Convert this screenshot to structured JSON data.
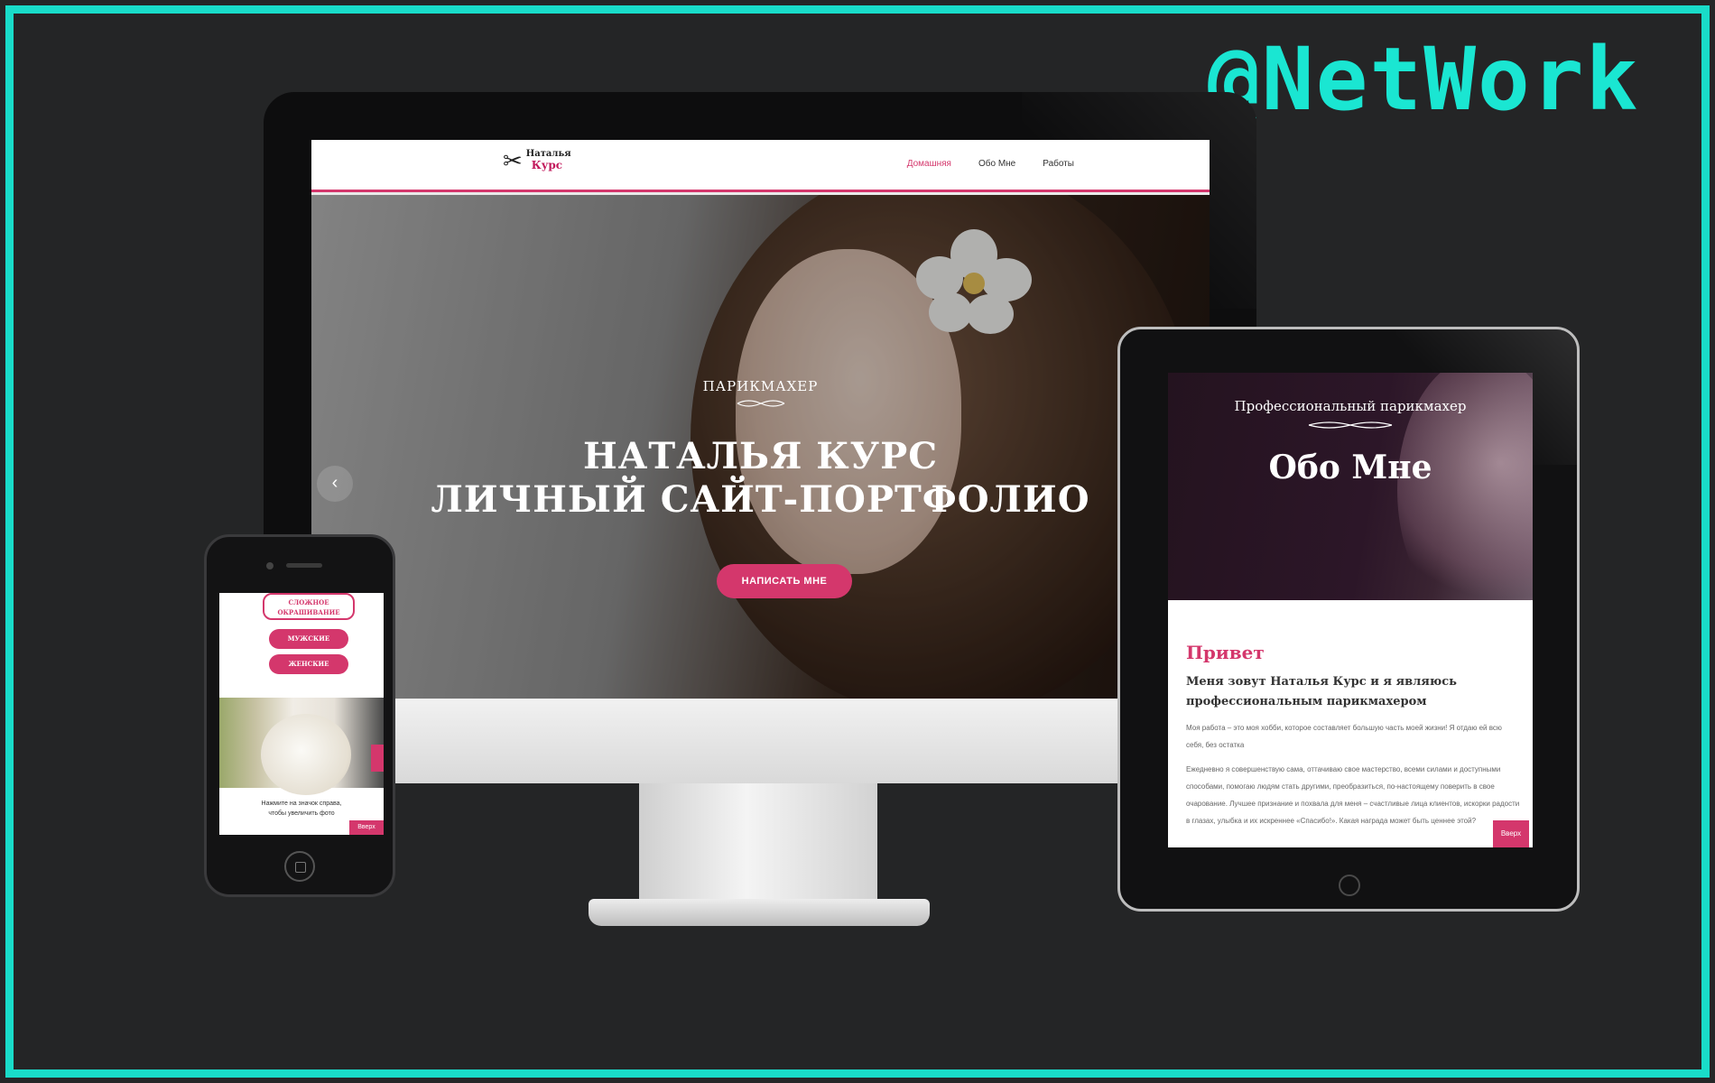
{
  "watermark": "@NetWork",
  "desktop": {
    "logo_line1": "Наталья",
    "logo_line2": "Курс",
    "menu": [
      "Домашняя",
      "Обо Мне",
      "Работы"
    ],
    "hero_kicker": "ПАРИКМАХЕР",
    "hero_title_line1": "НАТАЛЬЯ КУРС",
    "hero_title_line2": "ЛИЧНЫЙ САЙТ-ПОРТФОЛИО",
    "cta": "НАПИСАТЬ МНЕ"
  },
  "phone": {
    "outline_button": "СЛОЖНОЕ ОКРАШИВАНИЕ",
    "buttons": [
      "МУЖСКИЕ",
      "ЖЕНСКИЕ"
    ],
    "caption_line1": "Нажмите на значок справа,",
    "caption_line2": "чтобы увеличить фото",
    "top_button": "Вверх"
  },
  "tablet": {
    "hero_sub": "Профессиональный парикмахер",
    "hero_title": "Обо Мне",
    "greeting": "Привет",
    "intro_line1": "Меня зовут Наталья Курс и я являюсь",
    "intro_line2": "профессиональным парикмахером",
    "p1": "Моя работа – это моя хобби, которое составляет большую часть моей жизни! Я отдаю ей всю себя, без остатка",
    "p2": "Ежедневно я совершенствую сама, оттачиваю свое мастерство, всеми силами и доступными способами, помогаю людям стать другими, преобразиться, по-настоящему поверить в свое очарование. Лучшее признание и похвала для меня – счастливые лица клиентов, искорки радости в глазах, улыбка и их искреннее «Спасибо!». Какая награда может быть ценнее этой?",
    "top_button": "Вверх"
  },
  "colors": {
    "accent": "#d4376c",
    "frame": "#19dcc9",
    "background": "#252627"
  }
}
